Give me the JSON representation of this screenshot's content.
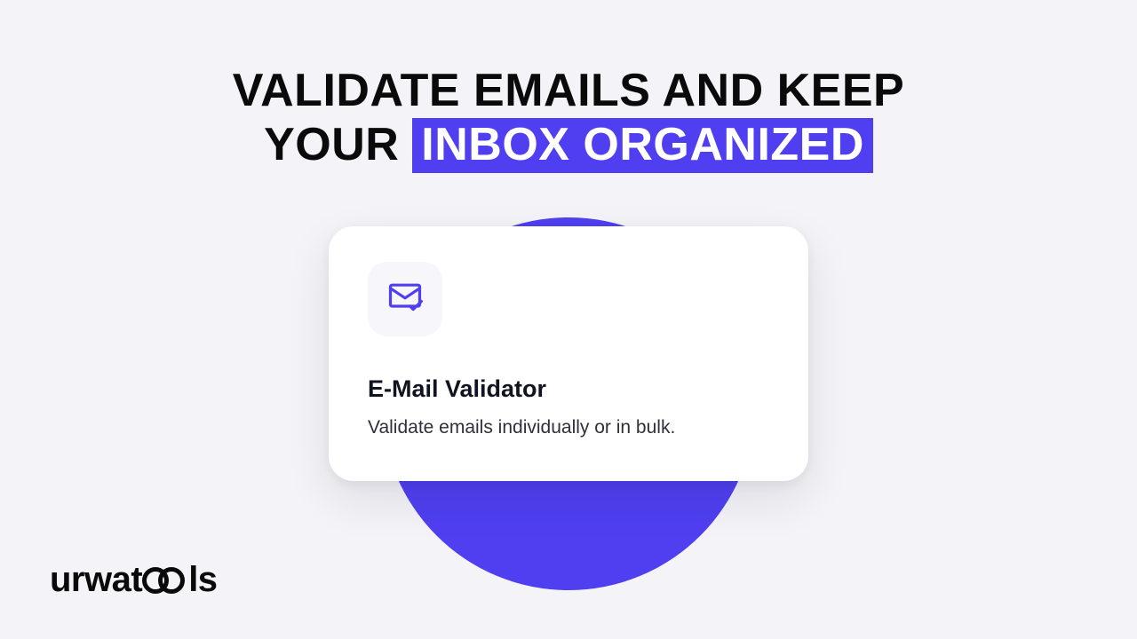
{
  "headline": {
    "line1": "VALIDATE EMAILS AND KEEP",
    "line2_prefix": "YOUR ",
    "line2_highlight": "INBOX ORGANIZED"
  },
  "card": {
    "title": "E-Mail Validator",
    "description": "Validate emails individually or in bulk."
  },
  "brand": {
    "prefix": "urwat",
    "suffix": "ls"
  },
  "colors": {
    "accent": "#4f3ff0",
    "background": "#f4f3f7"
  }
}
